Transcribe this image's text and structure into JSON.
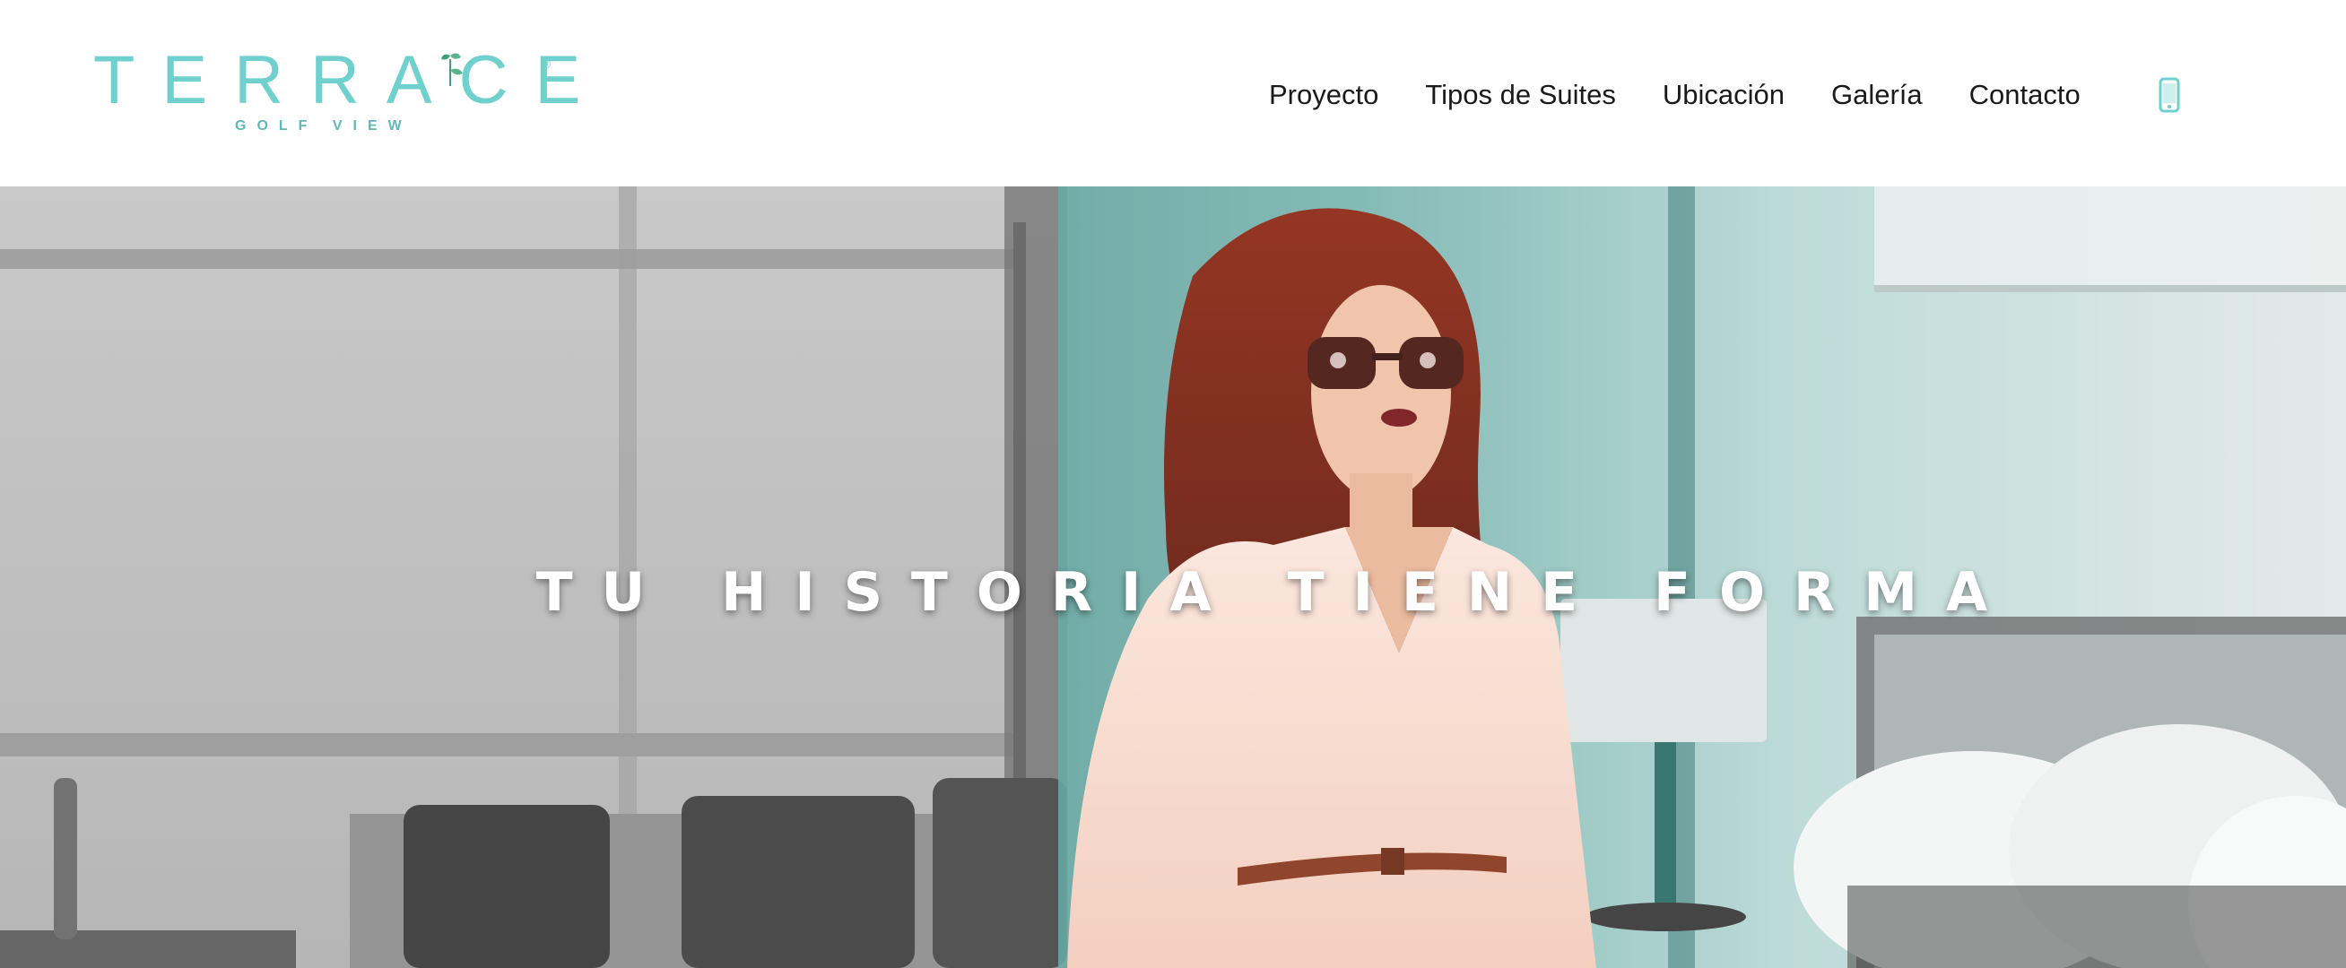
{
  "logo": {
    "name": "TERRACE",
    "subtitle": "GOLF VIEW",
    "registered_mark": "®",
    "color": "#6fd0cd"
  },
  "nav": {
    "items": [
      {
        "label": "Proyecto"
      },
      {
        "label": "Tipos de Suites"
      },
      {
        "label": "Ubicación"
      },
      {
        "label": "Galería"
      },
      {
        "label": "Contacto"
      }
    ],
    "text_color": "#1a1a1a",
    "phone_icon": "mobile-phone-icon",
    "phone_icon_color": "#6fd0cd"
  },
  "hero": {
    "headline": "TU HISTORIA TIENE FORMA",
    "image_description_icon": "hero-photo-woman-in-suite"
  }
}
